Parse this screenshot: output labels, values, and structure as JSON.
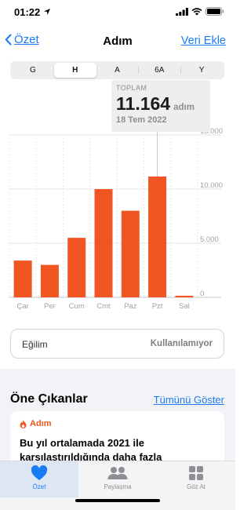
{
  "status_bar": {
    "time": "01:22"
  },
  "nav": {
    "back_label": "Özet",
    "title": "Adım",
    "action_label": "Veri Ekle"
  },
  "segments": [
    {
      "label": "G",
      "active": false
    },
    {
      "label": "H",
      "active": true
    },
    {
      "label": "A",
      "active": false
    },
    {
      "label": "6A",
      "active": false
    },
    {
      "label": "Y",
      "active": false
    }
  ],
  "tooltip": {
    "label": "TOPLAM",
    "value": "11.164",
    "unit": "adım",
    "date": "18 Tem 2022"
  },
  "chart_data": {
    "type": "bar",
    "categories": [
      "Çar",
      "Per",
      "Cum",
      "Cmt",
      "Paz",
      "Pzt",
      "Sal"
    ],
    "values": [
      3400,
      3000,
      5500,
      10000,
      8000,
      11164,
      150
    ],
    "y_ticks": [
      0,
      5000,
      10000,
      15000
    ],
    "y_tick_labels": [
      "0",
      "5.000",
      "10.000",
      "15.000"
    ],
    "ylim": [
      0,
      15000
    ],
    "selected_index": 5,
    "bar_color": "#f05522",
    "grid": true
  },
  "trend": {
    "label": "Eğilim",
    "value": "Kullanılamıyor"
  },
  "highlights": {
    "title": "Öne Çıkanlar",
    "link": "Tümünü Göster",
    "card_header": "Adım",
    "card_text": "Bu yıl ortalamada 2021 ile karşılaştırıldığında daha fazla"
  },
  "tabs": [
    {
      "label": "Özet",
      "icon": "heart-icon",
      "active": true
    },
    {
      "label": "Paylaşma",
      "icon": "people-icon",
      "active": false
    },
    {
      "label": "Göz At",
      "icon": "grid-icon",
      "active": false
    }
  ],
  "colors": {
    "accent": "#1a7cf5",
    "bar": "#f05522"
  }
}
